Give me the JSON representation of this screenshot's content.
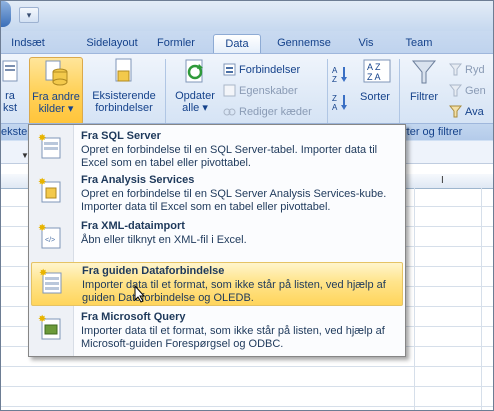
{
  "qat": {
    "dropdown_icon": "customize-qat-arrow-icon"
  },
  "tabs": [
    {
      "label": "Indsæt"
    },
    {
      "label": "Sidelayout"
    },
    {
      "label": "Formler"
    },
    {
      "label": "Data",
      "active": true
    },
    {
      "label": "Gennemse"
    },
    {
      "label": "Vis"
    },
    {
      "label": "Team"
    }
  ],
  "ribbon": {
    "fra_tekst": {
      "line1": "ra",
      "line2": "kst"
    },
    "fra_andre_kilder": {
      "line1": "Fra andre",
      "line2": "kilder ▾"
    },
    "eksisterende": {
      "line1": "Eksisterende",
      "line2": "forbindelser"
    },
    "opdater": {
      "line1": "Opdater",
      "line2": "alle ▾"
    },
    "forbindelser": "Forbindelser",
    "egenskaber": "Egenskaber",
    "rediger": "Rediger kæder",
    "sorter": "Sorter",
    "filtrer": "Filtrer",
    "ryd": "Ryd",
    "gentag": "Gen",
    "avanceret": "Ava",
    "group_left_label": "ekste",
    "group_sort_label": "rter og filtrer"
  },
  "grid": {
    "column_label": "I"
  },
  "menu": {
    "items": [
      {
        "title": "Fra SQL Server",
        "desc": "Opret en forbindelse til en SQL Server-tabel. Importer data til Excel som en tabel eller pivottabel."
      },
      {
        "title": "Fra Analysis Services",
        "desc": "Opret en forbindelse til en SQL Server Analysis Services-kube. Importer data til Excel som en tabel eller pivottabel."
      },
      {
        "title": "Fra XML-dataimport",
        "desc": "Åbn eller tilknyt en XML-fil i Excel."
      },
      {
        "title": "Fra guiden Dataforbindelse",
        "desc": "Importer data til et format, som ikke står på listen, ved hjælp af guiden Dataforbindelse og OLEDB.",
        "highlighted": true
      },
      {
        "title": "Fra Microsoft Query",
        "desc": "Importer data til et format, som ikke står på listen, ved hjælp af Microsoft-guiden Forespørgsel og ODBC."
      }
    ]
  },
  "colors": {
    "accent": "#15428b",
    "highlight": "#ffd55c",
    "ribbon": "#dbe7f6"
  }
}
